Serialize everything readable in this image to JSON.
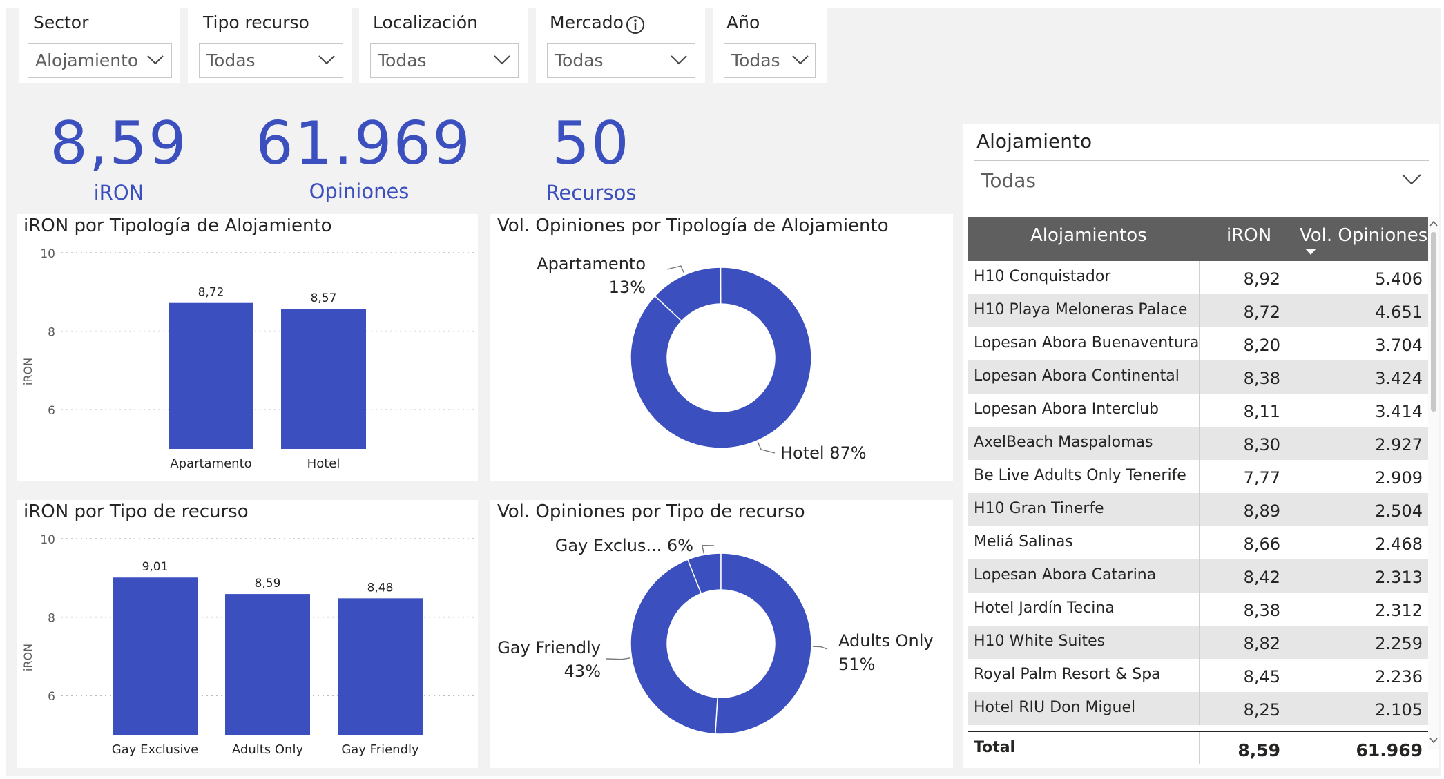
{
  "slicers": [
    {
      "title": "Sector",
      "value": "Alojamiento"
    },
    {
      "title": "Tipo recurso",
      "value": "Todas"
    },
    {
      "title": "Localización",
      "value": "Todas"
    },
    {
      "title": "Mercado",
      "value": "Todas"
    },
    {
      "title": "Año",
      "value": "Todas"
    }
  ],
  "kpis": [
    {
      "value": "8,59",
      "label": "iRON"
    },
    {
      "value": "61.969",
      "label": "Opiniones"
    },
    {
      "value": "50",
      "label": "Recursos"
    }
  ],
  "alojamiento_slicer": {
    "title": "Alojamiento",
    "value": "Todas"
  },
  "colors": {
    "accent": "#3b4fbf",
    "header": "#5f5f5f",
    "stripe": "#e6e6e6"
  },
  "table": {
    "headers": [
      "Alojamientos",
      "iRON",
      "Vol. Opiniones"
    ],
    "rows": [
      [
        "H10 Conquistador",
        "8,92",
        "5.406"
      ],
      [
        "H10 Playa Meloneras Palace",
        "8,72",
        "4.651"
      ],
      [
        "Lopesan Abora Buenaventura",
        "8,20",
        "3.704"
      ],
      [
        "Lopesan Abora Continental",
        "8,38",
        "3.424"
      ],
      [
        "Lopesan Abora Interclub",
        "8,11",
        "3.414"
      ],
      [
        "AxelBeach Maspalomas",
        "8,30",
        "2.927"
      ],
      [
        "Be Live Adults Only Tenerife",
        "7,77",
        "2.909"
      ],
      [
        "H10 Gran Tinerfe",
        "8,89",
        "2.504"
      ],
      [
        "Meliá Salinas",
        "8,66",
        "2.468"
      ],
      [
        "Lopesan Abora Catarina",
        "8,42",
        "2.313"
      ],
      [
        "Hotel Jardín Tecina",
        "8,38",
        "2.312"
      ],
      [
        "H10 White Suites",
        "8,82",
        "2.259"
      ],
      [
        "Royal Palm Resort & Spa",
        "8,45",
        "2.236"
      ],
      [
        "Hotel RIU Don Miguel",
        "8,25",
        "2.105"
      ]
    ],
    "total": [
      "Total",
      "8,59",
      "61.969"
    ]
  },
  "chart_data": [
    {
      "type": "bar",
      "title": "iRON por Tipología de Alojamiento",
      "ylabel": "iRON",
      "categories": [
        "Apartamento",
        "Hotel"
      ],
      "values": [
        8.72,
        8.57
      ],
      "value_labels": [
        "8,72",
        "8,57"
      ],
      "ylim": [
        5,
        10
      ],
      "yticks": [
        6,
        8,
        10
      ],
      "grid": true
    },
    {
      "type": "pie",
      "title": "Vol. Opiniones por Tipología de Alojamiento",
      "categories": [
        "Apartamento",
        "Hotel"
      ],
      "values": [
        13,
        87
      ],
      "labels": [
        [
          "Apartamento",
          "13%"
        ],
        [
          "Hotel 87%"
        ]
      ]
    },
    {
      "type": "bar",
      "title": "iRON por Tipo de recurso",
      "ylabel": "iRON",
      "categories": [
        "Gay Exclusive",
        "Adults Only",
        "Gay Friendly"
      ],
      "values": [
        9.01,
        8.59,
        8.48
      ],
      "value_labels": [
        "9,01",
        "8,59",
        "8,48"
      ],
      "ylim": [
        5,
        10
      ],
      "yticks": [
        6,
        8,
        10
      ],
      "grid": true
    },
    {
      "type": "pie",
      "title": "Vol. Opiniones por Tipo de recurso",
      "categories": [
        "Gay Exclusive",
        "Adults Only",
        "Gay Friendly"
      ],
      "values": [
        6,
        51,
        43
      ],
      "labels": [
        [
          "Gay Exclus... 6%"
        ],
        [
          "Adults Only",
          "51%"
        ],
        [
          "Gay Friendly",
          "43%"
        ]
      ]
    }
  ]
}
